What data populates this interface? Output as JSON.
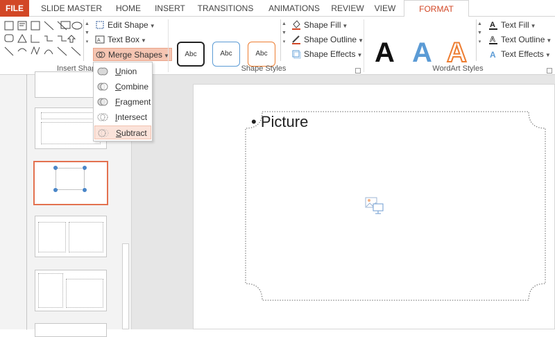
{
  "tabs": [
    {
      "id": "file",
      "label": "FILE"
    },
    {
      "id": "slide_master",
      "label": "SLIDE MASTER"
    },
    {
      "id": "home",
      "label": "HOME"
    },
    {
      "id": "insert",
      "label": "INSERT"
    },
    {
      "id": "transitions",
      "label": "TRANSITIONS"
    },
    {
      "id": "animations",
      "label": "ANIMATIONS"
    },
    {
      "id": "review",
      "label": "REVIEW"
    },
    {
      "id": "view",
      "label": "VIEW"
    },
    {
      "id": "format",
      "label": "FORMAT"
    }
  ],
  "ribbon": {
    "insert_shapes": {
      "label": "Insert Shapes",
      "edit_shape": "Edit Shape",
      "text_box": "Text Box",
      "merge_shapes": "Merge Shapes"
    },
    "shape_styles": {
      "label": "Shape Styles",
      "presets": [
        "Abc",
        "Abc",
        "Abc"
      ],
      "shape_fill": "Shape Fill",
      "shape_outline": "Shape Outline",
      "shape_effects": "Shape Effects"
    },
    "wordart_styles": {
      "label": "WordArt Styles",
      "letters": [
        "A",
        "A",
        "A"
      ],
      "text_fill": "Text Fill",
      "text_outline": "Text Outline",
      "text_effects": "Text Effects"
    }
  },
  "merge_menu": {
    "items": [
      {
        "label": "Union",
        "underline": "U"
      },
      {
        "label": "Combine",
        "underline": "C"
      },
      {
        "label": "Fragment",
        "underline": "F"
      },
      {
        "label": "Intersect",
        "underline": "I"
      },
      {
        "label": "Subtract",
        "underline": "S"
      }
    ],
    "hovered": "Subtract"
  },
  "slide": {
    "placeholder_text": "Picture"
  },
  "colors": {
    "accent": "#d24726",
    "merge_active_bg": "#f5c5b2",
    "selected_thumb_border": "#e3714f"
  }
}
